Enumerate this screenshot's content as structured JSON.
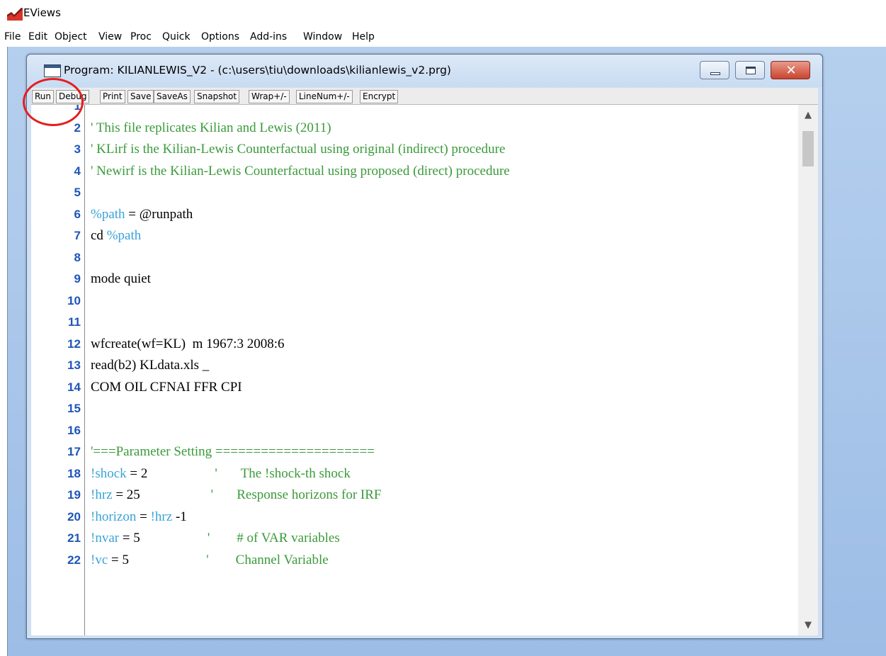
{
  "app": {
    "title": "EViews",
    "logo": "eviews-logo-icon"
  },
  "menu": [
    "File",
    "Edit",
    "Object",
    "View",
    "Proc",
    "Quick",
    "Options",
    "Add-ins",
    "Window",
    "Help"
  ],
  "window": {
    "title": "Program: KILIANLEWIS_V2 - (c:\\users\\tiu\\downloads\\kilianlewis_v2.prg)",
    "controls": {
      "minimize": "minimize-icon",
      "maximize": "maximize-icon",
      "close": "✕"
    }
  },
  "toolbar": {
    "buttons": [
      "Run",
      "Debug",
      "Print",
      "Save",
      "SaveAs",
      "Snapshot",
      "Wrap+/-",
      "LineNum+/-",
      "Encrypt"
    ]
  },
  "editor": {
    "lines": [
      {
        "num": "1",
        "parts": []
      },
      {
        "num": "2",
        "parts": [
          {
            "t": "' This file replicates Kilian and Lewis (2011)",
            "c": "comment"
          }
        ]
      },
      {
        "num": "3",
        "parts": [
          {
            "t": "' KLirf is the Kilian-Lewis Counterfactual using original (indirect) procedure",
            "c": "comment"
          }
        ]
      },
      {
        "num": "4",
        "parts": [
          {
            "t": "' Newirf is the Kilian-Lewis Counterfactual using proposed (direct) procedure",
            "c": "comment"
          }
        ]
      },
      {
        "num": "5",
        "parts": []
      },
      {
        "num": "6",
        "parts": [
          {
            "t": "%path",
            "c": "var"
          },
          {
            "t": " = @runpath",
            "c": "plain"
          }
        ]
      },
      {
        "num": "7",
        "parts": [
          {
            "t": "cd ",
            "c": "plain"
          },
          {
            "t": "%path",
            "c": "var"
          }
        ]
      },
      {
        "num": "8",
        "parts": []
      },
      {
        "num": "9",
        "parts": [
          {
            "t": "mode quiet",
            "c": "plain"
          }
        ]
      },
      {
        "num": "10",
        "parts": []
      },
      {
        "num": "11",
        "parts": []
      },
      {
        "num": "12",
        "parts": [
          {
            "t": "wfcreate(wf=KL)  m 1967:3 2008:6",
            "c": "plain"
          }
        ]
      },
      {
        "num": "13",
        "parts": [
          {
            "t": "read(b2) KLdata.xls _",
            "c": "plain"
          }
        ]
      },
      {
        "num": "14",
        "parts": [
          {
            "t": "COM OIL CFNAI FFR CPI",
            "c": "plain"
          }
        ]
      },
      {
        "num": "15",
        "parts": []
      },
      {
        "num": "16",
        "parts": []
      },
      {
        "num": "17",
        "parts": [
          {
            "t": "'===Parameter Setting =====================",
            "c": "comment"
          }
        ]
      },
      {
        "num": "18",
        "parts": [
          {
            "t": "!shock",
            "c": "var"
          },
          {
            "t": " = 2",
            "c": "plain"
          },
          {
            "t": "                    '       The !shock-th shock",
            "c": "comment"
          }
        ]
      },
      {
        "num": "19",
        "parts": [
          {
            "t": "!hrz",
            "c": "var"
          },
          {
            "t": " = 25",
            "c": "plain"
          },
          {
            "t": "                     '       Response horizons for IRF",
            "c": "comment"
          }
        ]
      },
      {
        "num": "20",
        "parts": [
          {
            "t": "!horizon",
            "c": "var"
          },
          {
            "t": " = ",
            "c": "plain"
          },
          {
            "t": "!hrz",
            "c": "var"
          },
          {
            "t": " -1",
            "c": "plain"
          }
        ]
      },
      {
        "num": "21",
        "parts": [
          {
            "t": "!nvar",
            "c": "var"
          },
          {
            "t": " = 5",
            "c": "plain"
          },
          {
            "t": "                    '        # of VAR variables",
            "c": "comment"
          }
        ]
      },
      {
        "num": "22",
        "parts": [
          {
            "t": "!vc",
            "c": "var"
          },
          {
            "t": " = 5",
            "c": "plain"
          },
          {
            "t": "                       '        Channel Variable",
            "c": "comment"
          }
        ]
      }
    ],
    "scroll": {
      "up": "▲",
      "down": "▼"
    }
  },
  "annotation": {
    "highlight": "red-circle-highlight-on-run-button"
  },
  "colors": {
    "comment": "#3a9a3a",
    "variable": "#3aa3d8",
    "line_number": "#1f55b8",
    "highlight": "#e41f1f"
  }
}
